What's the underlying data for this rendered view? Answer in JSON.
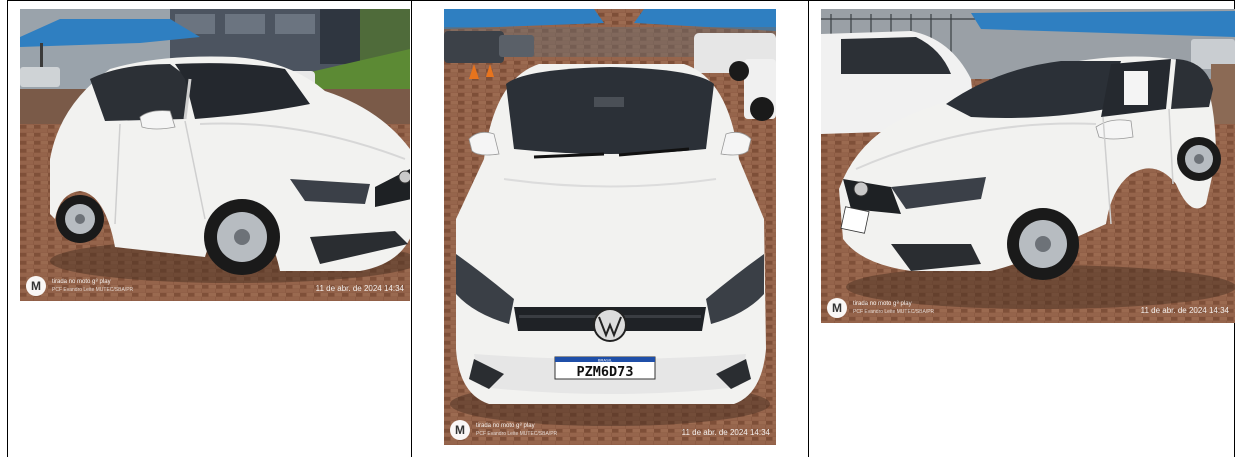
{
  "photos": [
    {
      "watermark_line1": "tirada no moto g⁸ play",
      "watermark_line2": "PCF Evandro Leite MUTEC/SBA/PR",
      "timestamp": "11 de abr. de 2024 14:34"
    },
    {
      "watermark_line1": "tirada no moto g⁸ play",
      "watermark_line2": "PCF Evandro Leite MUTEC/SBA/PR",
      "timestamp": "11 de abr. de 2024 14:34",
      "plate_country": "BRASIL",
      "plate_number": "PZM6D73"
    },
    {
      "watermark_line1": "tirada no moto g⁸ play",
      "watermark_line2": "PCF Evandro Leite MUTEC/SBA/PR",
      "timestamp": "11 de abr. de 2024 14:34"
    }
  ],
  "icons": {
    "camera_brand_logo": "motorola-logo-icon"
  },
  "colors": {
    "car_body": "#f2f2f0",
    "pavement_brick": "#8a5a42",
    "canopy_blue": "#2f7fc1",
    "table_border": "#000000"
  }
}
